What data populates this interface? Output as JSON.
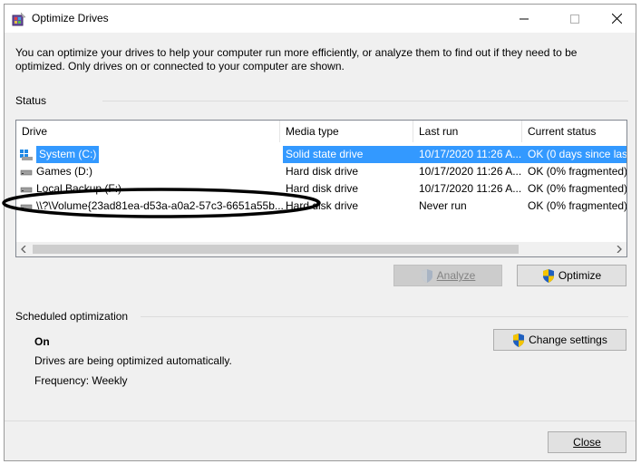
{
  "window": {
    "title": "Optimize Drives",
    "description": "You can optimize your drives to help your computer run more efficiently, or analyze them to find out if they need to be optimized. Only drives on or connected to your computer are shown."
  },
  "status": {
    "label": "Status",
    "columns": [
      "Drive",
      "Media type",
      "Last run",
      "Current status"
    ],
    "rows": [
      {
        "drive": "System (C:)",
        "media": "Solid state drive",
        "last_run": "10/17/2020 11:26 A...",
        "status": "OK (0 days since last",
        "selected": true
      },
      {
        "drive": "Games (D:)",
        "media": "Hard disk drive",
        "last_run": "10/17/2020 11:26 A...",
        "status": "OK (0% fragmented)",
        "selected": false
      },
      {
        "drive": "Local Backup (F:)",
        "media": "Hard disk drive",
        "last_run": "10/17/2020 11:26 A...",
        "status": "OK (0% fragmented)",
        "selected": false
      },
      {
        "drive": "\\\\?\\Volume{23ad81ea-d53a-a0a2-57c3-6651a55b...",
        "media": "Hard disk drive",
        "last_run": "Never run",
        "status": "OK (0% fragmented)",
        "selected": false
      }
    ]
  },
  "buttons": {
    "analyze": "Analyze",
    "optimize": "Optimize",
    "change_settings": "Change settings",
    "close": "Close"
  },
  "scheduled": {
    "label": "Scheduled optimization",
    "state": "On",
    "detail": "Drives are being optimized automatically.",
    "frequency": "Frequency: Weekly"
  },
  "colors": {
    "selection": "#3399ff",
    "row_highlight": "#cce8ff",
    "annotation": "#000000"
  }
}
